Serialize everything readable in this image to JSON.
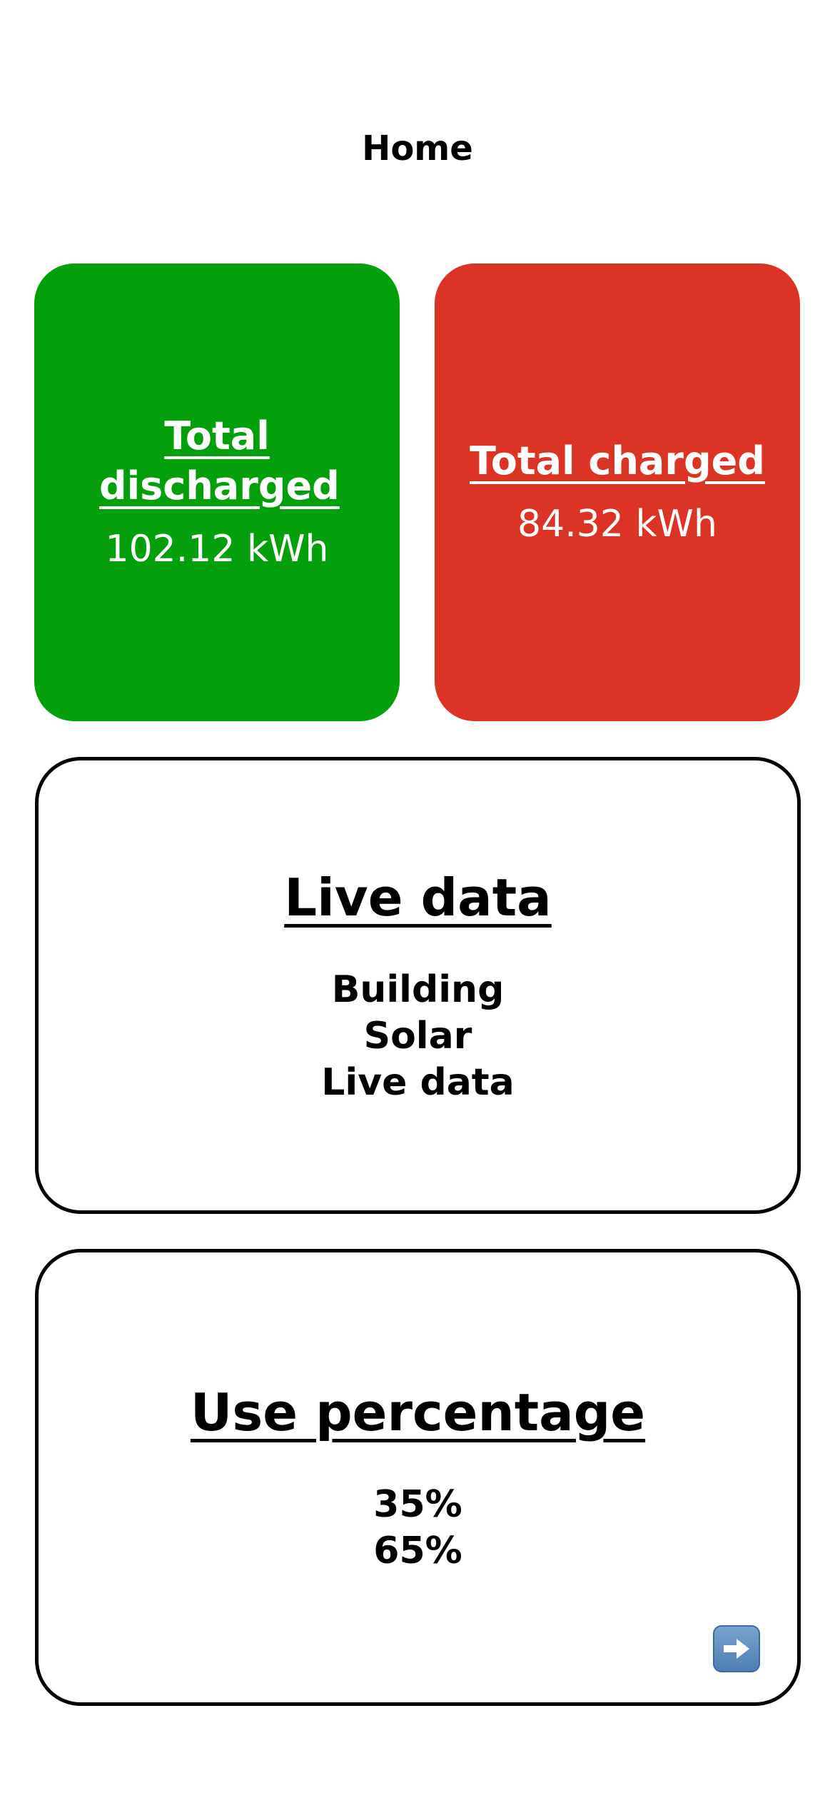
{
  "header": {
    "title": "Home"
  },
  "stats": {
    "discharged": {
      "title": "Total discharged",
      "value": "102.12 kWh"
    },
    "charged": {
      "title": "Total charged",
      "value": "84.32 kWh"
    }
  },
  "live_data": {
    "title": "Live data",
    "items": [
      "Building",
      "Solar",
      "Live data"
    ]
  },
  "use_percentage": {
    "title": "Use percentage",
    "values": [
      "35%",
      "65%"
    ]
  },
  "icons": {
    "next": "right-arrow-icon"
  },
  "colors": {
    "discharged": "#049F0C",
    "charged": "#DC3327",
    "outline": "#000000",
    "arrow_button": "#5E8CC0"
  }
}
